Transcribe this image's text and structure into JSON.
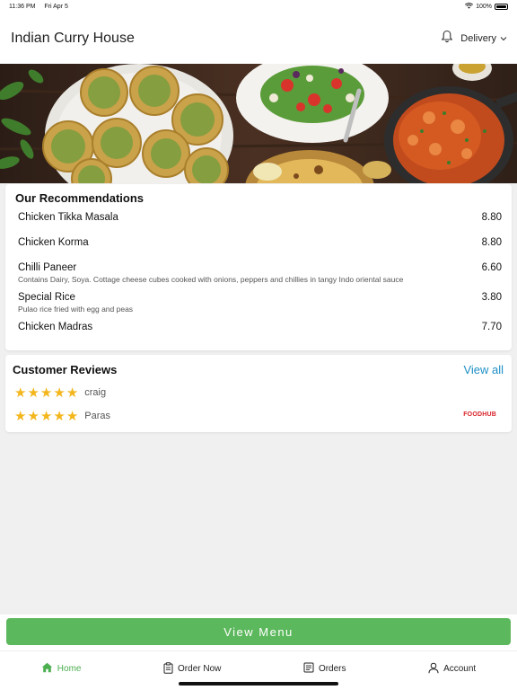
{
  "status_bar": {
    "time": "11:36 PM",
    "date": "Fri Apr 5",
    "battery": "100%"
  },
  "header": {
    "title": "Indian Curry House",
    "mode": "Delivery",
    "icons": [
      "bell-icon",
      "chevron-down-icon"
    ]
  },
  "recommendations": {
    "title": "Our Recommendations",
    "items": [
      {
        "name": "Chicken Tikka Masala",
        "desc": "",
        "price": "8.80"
      },
      {
        "name": "Chicken Korma",
        "desc": "",
        "price": "8.80"
      },
      {
        "name": "Chilli Paneer",
        "desc": "Contains Dairy, Soya. Cottage cheese cubes cooked with onions, peppers and chillies in tangy Indo oriental sauce",
        "price": "6.60"
      },
      {
        "name": "Special Rice",
        "desc": "Pulao rice fried with egg and peas",
        "price": "3.80"
      },
      {
        "name": "Chicken Madras",
        "desc": "",
        "price": "7.70"
      }
    ]
  },
  "reviews": {
    "title": "Customer Reviews",
    "view_all": "View all",
    "items": [
      {
        "name": "craig",
        "rating": 5
      },
      {
        "name": "Paras",
        "rating": 5,
        "source": "FOODHUB"
      }
    ]
  },
  "view_menu_label": "View Menu",
  "tabs": [
    {
      "label": "Home",
      "icon": "home-icon",
      "active": true
    },
    {
      "label": "Order Now",
      "icon": "clipboard-icon"
    },
    {
      "label": "Orders",
      "icon": "orders-list-icon"
    },
    {
      "label": "Account",
      "icon": "person-icon"
    }
  ],
  "colors": {
    "accent_green": "#5cb85c",
    "link_blue": "#1f8fc7",
    "star_yellow": "#f3b61c",
    "foodhub_red": "#d8232a"
  }
}
